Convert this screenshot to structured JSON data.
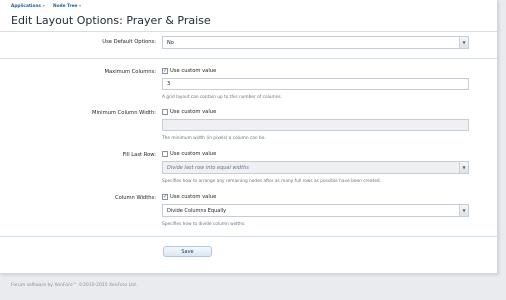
{
  "breadcrumb": [
    "Applications",
    "Node Tree"
  ],
  "page_title": "Edit Layout Options: Prayer & Praise",
  "use_default": {
    "label": "Use Default Options:",
    "value": "No"
  },
  "max_columns": {
    "label": "Maximum Columns:",
    "checkbox_label": "Use custom value",
    "checked": true,
    "value": "3",
    "hint": "A grid layout can contain up to this number of columns."
  },
  "min_column_width": {
    "label": "Minimum Column Width:",
    "checkbox_label": "Use custom value",
    "checked": false,
    "value": "",
    "hint": "The minimum width (in pixels) a column can be."
  },
  "fill_last_row": {
    "label": "Fill Last Row:",
    "checkbox_label": "Use custom value",
    "checked": false,
    "value": "Divide last row into equal widths",
    "hint": "Specifies how to arrange any remaining nodes after as many full rows as possible have been created."
  },
  "column_widths": {
    "label": "Column Widths:",
    "checkbox_label": "Use custom value",
    "checked": true,
    "value": "Divide Columns Equally",
    "hint": "Specifies how to divide column widths."
  },
  "save_label": "Save",
  "footer": "Forum software by XenForo™ ©2010-2015 XenForo Ltd.",
  "icons": {
    "dropdown": "chevron-down-icon",
    "checkmark": "checkmark-icon"
  }
}
